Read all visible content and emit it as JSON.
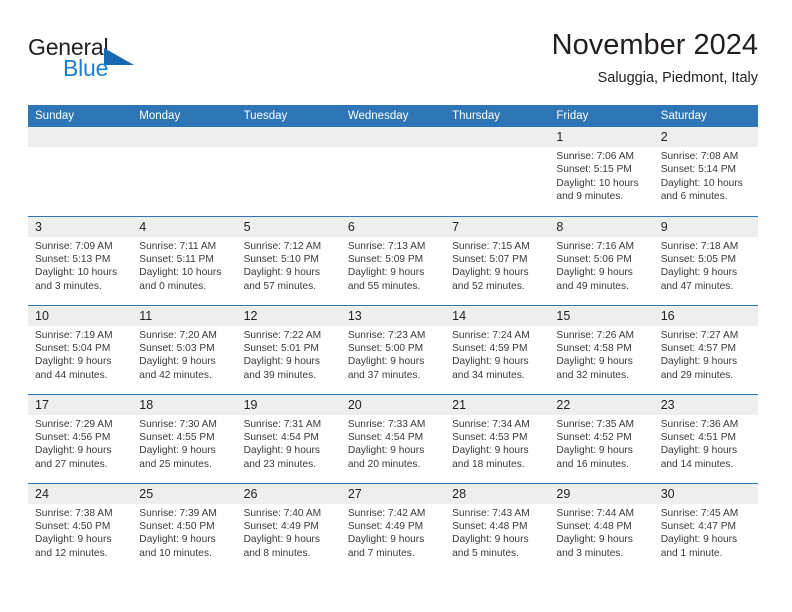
{
  "brand": {
    "name_part1": "General",
    "name_part2": "Blue",
    "triangle_icon": "triangle-icon",
    "colors": {
      "dark": "#231f20",
      "blue": "#1b7fd4",
      "triangle": "#1668b3"
    }
  },
  "header": {
    "title": "November 2024",
    "subtitle": "Saluggia, Piedmont, Italy"
  },
  "theme": {
    "header_row_bg": "#2e75b6",
    "header_row_text": "#ffffff",
    "daynum_bg": "#eeeeee",
    "row_divider": "#2e75b6",
    "body_text": "#3a3a3a"
  },
  "calendar": {
    "weekday_headers": [
      "Sunday",
      "Monday",
      "Tuesday",
      "Wednesday",
      "Thursday",
      "Friday",
      "Saturday"
    ],
    "weeks": [
      [
        {
          "day": "",
          "lines": []
        },
        {
          "day": "",
          "lines": []
        },
        {
          "day": "",
          "lines": []
        },
        {
          "day": "",
          "lines": []
        },
        {
          "day": "",
          "lines": []
        },
        {
          "day": "1",
          "lines": [
            "Sunrise: 7:06 AM",
            "Sunset: 5:15 PM",
            "Daylight: 10 hours and 9 minutes."
          ]
        },
        {
          "day": "2",
          "lines": [
            "Sunrise: 7:08 AM",
            "Sunset: 5:14 PM",
            "Daylight: 10 hours and 6 minutes."
          ]
        }
      ],
      [
        {
          "day": "3",
          "lines": [
            "Sunrise: 7:09 AM",
            "Sunset: 5:13 PM",
            "Daylight: 10 hours and 3 minutes."
          ]
        },
        {
          "day": "4",
          "lines": [
            "Sunrise: 7:11 AM",
            "Sunset: 5:11 PM",
            "Daylight: 10 hours and 0 minutes."
          ]
        },
        {
          "day": "5",
          "lines": [
            "Sunrise: 7:12 AM",
            "Sunset: 5:10 PM",
            "Daylight: 9 hours and 57 minutes."
          ]
        },
        {
          "day": "6",
          "lines": [
            "Sunrise: 7:13 AM",
            "Sunset: 5:09 PM",
            "Daylight: 9 hours and 55 minutes."
          ]
        },
        {
          "day": "7",
          "lines": [
            "Sunrise: 7:15 AM",
            "Sunset: 5:07 PM",
            "Daylight: 9 hours and 52 minutes."
          ]
        },
        {
          "day": "8",
          "lines": [
            "Sunrise: 7:16 AM",
            "Sunset: 5:06 PM",
            "Daylight: 9 hours and 49 minutes."
          ]
        },
        {
          "day": "9",
          "lines": [
            "Sunrise: 7:18 AM",
            "Sunset: 5:05 PM",
            "Daylight: 9 hours and 47 minutes."
          ]
        }
      ],
      [
        {
          "day": "10",
          "lines": [
            "Sunrise: 7:19 AM",
            "Sunset: 5:04 PM",
            "Daylight: 9 hours and 44 minutes."
          ]
        },
        {
          "day": "11",
          "lines": [
            "Sunrise: 7:20 AM",
            "Sunset: 5:03 PM",
            "Daylight: 9 hours and 42 minutes."
          ]
        },
        {
          "day": "12",
          "lines": [
            "Sunrise: 7:22 AM",
            "Sunset: 5:01 PM",
            "Daylight: 9 hours and 39 minutes."
          ]
        },
        {
          "day": "13",
          "lines": [
            "Sunrise: 7:23 AM",
            "Sunset: 5:00 PM",
            "Daylight: 9 hours and 37 minutes."
          ]
        },
        {
          "day": "14",
          "lines": [
            "Sunrise: 7:24 AM",
            "Sunset: 4:59 PM",
            "Daylight: 9 hours and 34 minutes."
          ]
        },
        {
          "day": "15",
          "lines": [
            "Sunrise: 7:26 AM",
            "Sunset: 4:58 PM",
            "Daylight: 9 hours and 32 minutes."
          ]
        },
        {
          "day": "16",
          "lines": [
            "Sunrise: 7:27 AM",
            "Sunset: 4:57 PM",
            "Daylight: 9 hours and 29 minutes."
          ]
        }
      ],
      [
        {
          "day": "17",
          "lines": [
            "Sunrise: 7:29 AM",
            "Sunset: 4:56 PM",
            "Daylight: 9 hours and 27 minutes."
          ]
        },
        {
          "day": "18",
          "lines": [
            "Sunrise: 7:30 AM",
            "Sunset: 4:55 PM",
            "Daylight: 9 hours and 25 minutes."
          ]
        },
        {
          "day": "19",
          "lines": [
            "Sunrise: 7:31 AM",
            "Sunset: 4:54 PM",
            "Daylight: 9 hours and 23 minutes."
          ]
        },
        {
          "day": "20",
          "lines": [
            "Sunrise: 7:33 AM",
            "Sunset: 4:54 PM",
            "Daylight: 9 hours and 20 minutes."
          ]
        },
        {
          "day": "21",
          "lines": [
            "Sunrise: 7:34 AM",
            "Sunset: 4:53 PM",
            "Daylight: 9 hours and 18 minutes."
          ]
        },
        {
          "day": "22",
          "lines": [
            "Sunrise: 7:35 AM",
            "Sunset: 4:52 PM",
            "Daylight: 9 hours and 16 minutes."
          ]
        },
        {
          "day": "23",
          "lines": [
            "Sunrise: 7:36 AM",
            "Sunset: 4:51 PM",
            "Daylight: 9 hours and 14 minutes."
          ]
        }
      ],
      [
        {
          "day": "24",
          "lines": [
            "Sunrise: 7:38 AM",
            "Sunset: 4:50 PM",
            "Daylight: 9 hours and 12 minutes."
          ]
        },
        {
          "day": "25",
          "lines": [
            "Sunrise: 7:39 AM",
            "Sunset: 4:50 PM",
            "Daylight: 9 hours and 10 minutes."
          ]
        },
        {
          "day": "26",
          "lines": [
            "Sunrise: 7:40 AM",
            "Sunset: 4:49 PM",
            "Daylight: 9 hours and 8 minutes."
          ]
        },
        {
          "day": "27",
          "lines": [
            "Sunrise: 7:42 AM",
            "Sunset: 4:49 PM",
            "Daylight: 9 hours and 7 minutes."
          ]
        },
        {
          "day": "28",
          "lines": [
            "Sunrise: 7:43 AM",
            "Sunset: 4:48 PM",
            "Daylight: 9 hours and 5 minutes."
          ]
        },
        {
          "day": "29",
          "lines": [
            "Sunrise: 7:44 AM",
            "Sunset: 4:48 PM",
            "Daylight: 9 hours and 3 minutes."
          ]
        },
        {
          "day": "30",
          "lines": [
            "Sunrise: 7:45 AM",
            "Sunset: 4:47 PM",
            "Daylight: 9 hours and 1 minute."
          ]
        }
      ]
    ]
  }
}
